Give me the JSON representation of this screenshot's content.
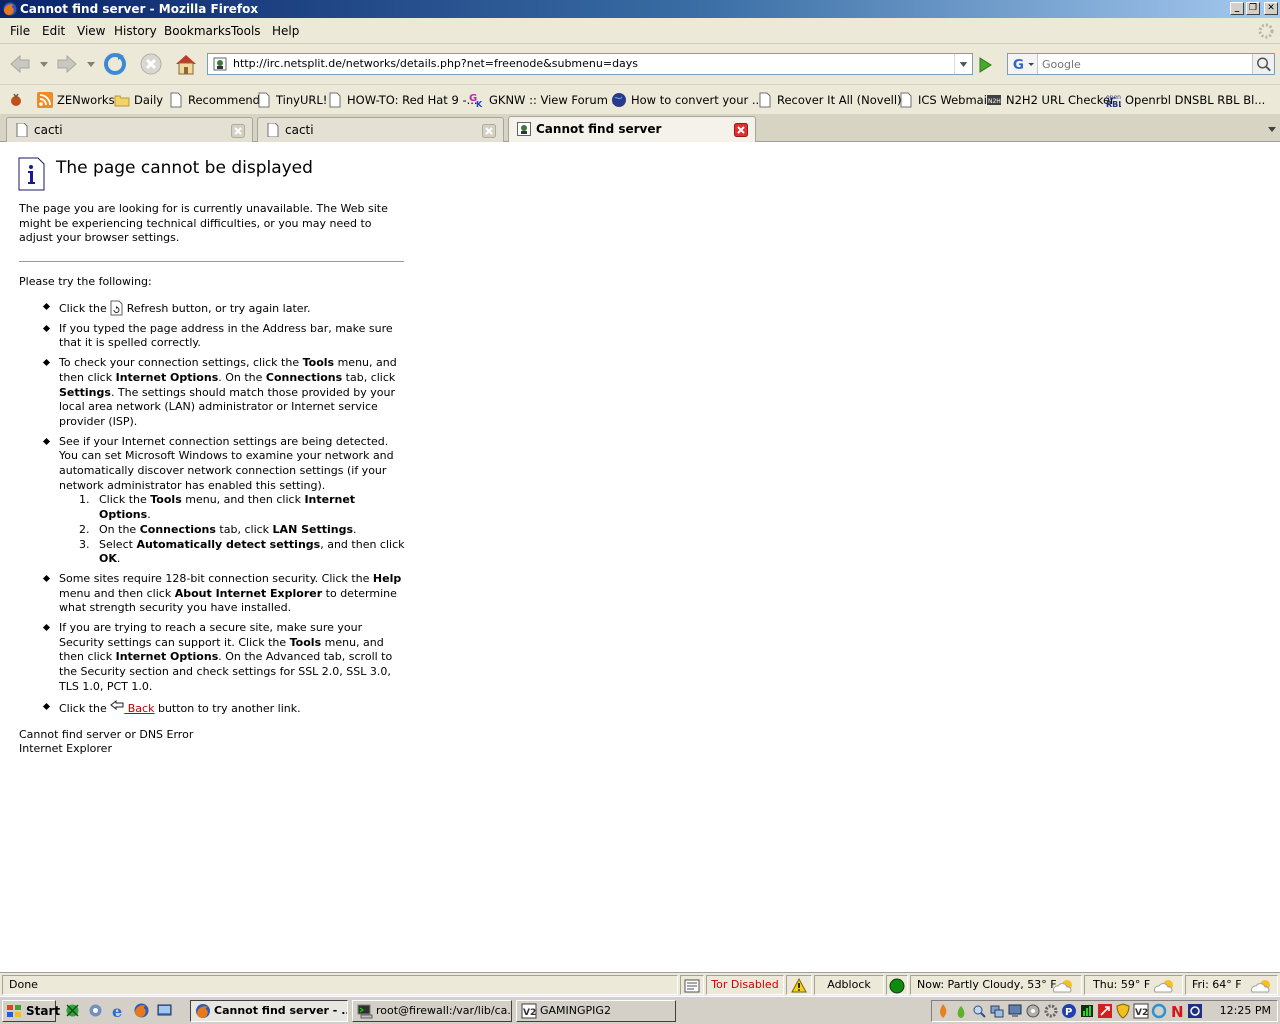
{
  "window": {
    "title": "Cannot find server - Mozilla Firefox"
  },
  "menu": {
    "items": [
      "File",
      "Edit",
      "View",
      "History",
      "Bookmarks",
      "Tools",
      "Help"
    ]
  },
  "navigation": {
    "url": "http://irc.netsplit.de/networks/details.php?net=freenode&submenu=days",
    "search_placeholder": "Google"
  },
  "bookmarks": [
    {
      "label": "ZENworks",
      "icon": "rss-feed-icon"
    },
    {
      "label": "Daily",
      "icon": "folder-icon"
    },
    {
      "label": "Recommend",
      "icon": "page-icon"
    },
    {
      "label": "TinyURL!",
      "icon": "page-icon"
    },
    {
      "label": "HOW-TO: Red Hat 9 -...",
      "icon": "page-icon"
    },
    {
      "label": "GKNW :: View Forum ...",
      "icon": "gknw-icon"
    },
    {
      "label": "How to convert your ...",
      "icon": "globe-icon"
    },
    {
      "label": "Recover It All (Novell)...",
      "icon": "page-icon"
    },
    {
      "label": "ICS Webmail",
      "icon": "page-icon"
    },
    {
      "label": "N2H2 URL Checker",
      "icon": "n2h2-icon"
    },
    {
      "label": "Openrbl DNSBL RBL Bl...",
      "icon": "openrbl-icon"
    }
  ],
  "tabs": [
    {
      "label": "cacti",
      "active": false
    },
    {
      "label": "cacti",
      "active": false
    },
    {
      "label": "Cannot find server",
      "active": true
    }
  ],
  "page": {
    "title": "The page cannot be displayed",
    "intro": "The page you are looking for is currently unavailable. The Web site might be experiencing technical difficulties, or you may need to adjust your browser settings.",
    "try_label": "Please try the following:",
    "tip1": {
      "a": "Click the ",
      "b": " Refresh button, or try again later."
    },
    "tip2": "If you typed the page address in the Address bar, make sure that it is spelled correctly.",
    "tip3": {
      "a": "To check your connection settings, click the ",
      "b": "Tools",
      "c": " menu, and then click ",
      "d": "Internet Options",
      "e": ". On the ",
      "f": "Connections",
      "g": " tab, click ",
      "h": "Settings",
      "i": ". The settings should match those provided by your local area network (LAN) administrator or Internet service provider (ISP)."
    },
    "tip4": {
      "text": "See if your Internet connection settings are being detected. You can set Microsoft Windows to examine your network and automatically discover network connection settings (if your network administrator has enabled this setting).",
      "steps": [
        {
          "num": "1.",
          "a": "Click the ",
          "b": "Tools",
          "c": " menu, and then click ",
          "d": "Internet Options",
          "e": "."
        },
        {
          "num": "2.",
          "a": "On the ",
          "b": "Connections",
          "c": " tab, click ",
          "d": "LAN Settings",
          "e": "."
        },
        {
          "num": "3.",
          "a": "Select ",
          "b": "Automatically detect settings",
          "c": ", and then click ",
          "d": "OK",
          "e": "."
        }
      ]
    },
    "tip5": {
      "a": "Some sites require 128-bit connection security. Click the ",
      "b": "Help",
      "c": " menu and then click ",
      "d": "About Internet Explorer",
      "e": " to determine what strength security you have installed."
    },
    "tip6": {
      "a": "If you are trying to reach a secure site, make sure your Security settings can support it. Click the ",
      "b": "Tools",
      "c": " menu, and then click ",
      "d": "Internet Options",
      "e": ". On the Advanced tab, scroll to the Security section and check settings for SSL 2.0, SSL 3.0, TLS 1.0, PCT 1.0."
    },
    "tip7": {
      "a": "Click the ",
      "link": " Back",
      "b": " button to try another link."
    },
    "footer_error": "Cannot find server or DNS Error",
    "footer_app": "Internet Explorer"
  },
  "status": {
    "text": "Done",
    "tor": "Tor Disabled",
    "adblock": "Adblock",
    "weather_now": "Now: Partly Cloudy, 53° F",
    "weather_thu": "Thu: 59° F",
    "weather_fri": "Fri: 64° F"
  },
  "taskbar": {
    "start_label": "Start",
    "windows": [
      {
        "label": "Cannot find server - ...",
        "active": true
      },
      {
        "label": "root@firewall:/var/lib/ca...",
        "active": false
      },
      {
        "label": "GAMINGPIG2",
        "active": false
      }
    ],
    "clock": "12:25 PM"
  },
  "colors": {
    "title_gradient_start": "#0a246a",
    "title_gradient_end": "#a6caf0",
    "chrome": "#ece9d8",
    "tor_text": "#cc0000",
    "link": "#c00000"
  }
}
